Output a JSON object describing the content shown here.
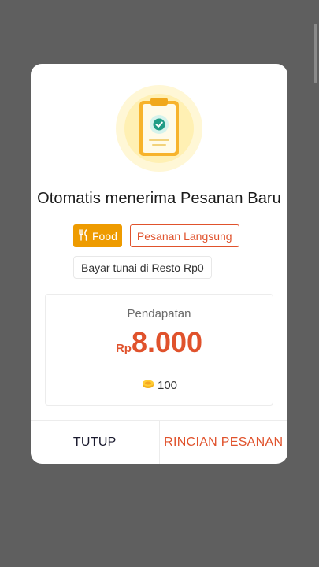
{
  "dialog": {
    "title": "Otomatis menerima Pesanan Baru",
    "badges": {
      "food_label": "Food",
      "order_type_label": "Pesanan Langsung",
      "payment_label": "Bayar tunai di Resto Rp0"
    },
    "income": {
      "label": "Pendapatan",
      "currency": "Rp",
      "amount": "8.000",
      "points": "100"
    },
    "buttons": {
      "close_label": "TUTUP",
      "detail_label": "RINCIAN PESANAN"
    }
  },
  "icons": {
    "illustration": "clipboard-check-icon",
    "food": "fork-knife-icon",
    "points": "coin-icon"
  },
  "colors": {
    "accent": "#e0522c",
    "food_badge": "#ee9b00",
    "backdrop": "#5f5f5f"
  }
}
